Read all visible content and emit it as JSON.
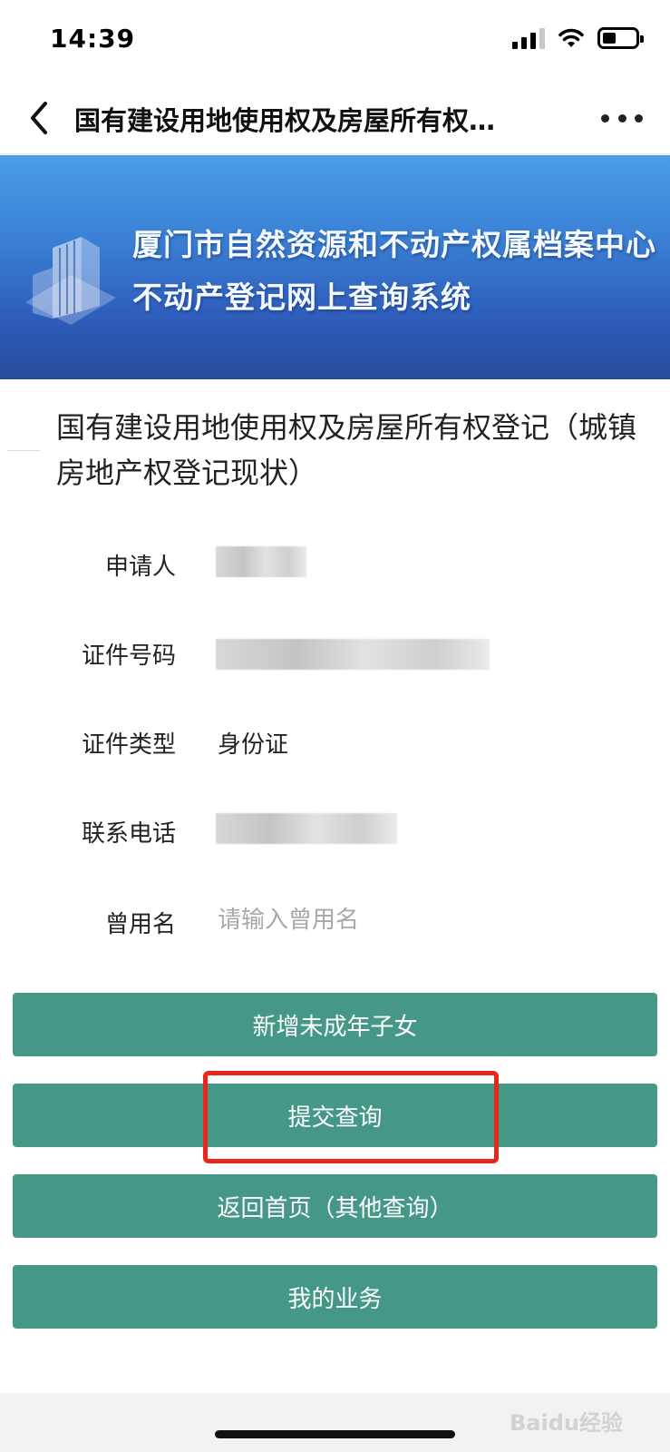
{
  "status_bar": {
    "time": "14:39"
  },
  "nav": {
    "title": "国有建设用地使用权及房屋所有权…"
  },
  "banner": {
    "line1": "厦门市自然资源和不动产权属档案中心",
    "line2": "不动产登记网上查询系统"
  },
  "page_title": "国有建设用地使用权及房屋所有权登记（城镇房地产权登记现状）",
  "form": {
    "applicant_label": "申请人",
    "id_number_label": "证件号码",
    "id_type_label": "证件类型",
    "id_type_value": "身份证",
    "phone_label": "联系电话",
    "former_name_label": "曾用名",
    "former_name_placeholder": "请输入曾用名"
  },
  "buttons": {
    "add_minor": "新增未成年子女",
    "submit": "提交查询",
    "back_home": "返回首页（其他查询）",
    "my_business": "我的业务"
  },
  "watermark": "Baidu经验",
  "colors": {
    "button_bg": "#459886",
    "highlight_border": "#e8261c",
    "banner_top": "#4a9ee8",
    "banner_bottom": "#284a9c"
  }
}
